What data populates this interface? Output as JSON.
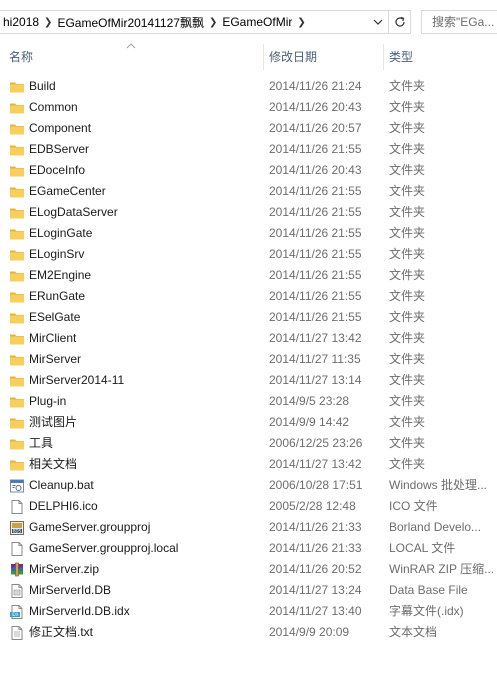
{
  "address": {
    "crumbs": [
      "hi2018",
      "EGameOfMir20141127飘飘",
      "EGameOfMir"
    ],
    "search_placeholder": "搜索\"EGa..."
  },
  "columns": {
    "name": "名称",
    "date": "修改日期",
    "type": "类型"
  },
  "colors": {
    "folder": "#f3c54a",
    "header_text": "#4c607a",
    "meta_text": "#6d6d6d"
  },
  "files": [
    {
      "name": "Build",
      "date": "2014/11/26 21:24",
      "type": "文件夹",
      "icon": "folder-icon"
    },
    {
      "name": "Common",
      "date": "2014/11/26 20:43",
      "type": "文件夹",
      "icon": "folder-icon"
    },
    {
      "name": "Component",
      "date": "2014/11/26 20:57",
      "type": "文件夹",
      "icon": "folder-icon"
    },
    {
      "name": "EDBServer",
      "date": "2014/11/26 21:55",
      "type": "文件夹",
      "icon": "folder-icon"
    },
    {
      "name": "EDoceInfo",
      "date": "2014/11/26 20:43",
      "type": "文件夹",
      "icon": "folder-icon"
    },
    {
      "name": "EGameCenter",
      "date": "2014/11/26 21:55",
      "type": "文件夹",
      "icon": "folder-icon"
    },
    {
      "name": "ELogDataServer",
      "date": "2014/11/26 21:55",
      "type": "文件夹",
      "icon": "folder-icon"
    },
    {
      "name": "ELoginGate",
      "date": "2014/11/26 21:55",
      "type": "文件夹",
      "icon": "folder-icon"
    },
    {
      "name": "ELoginSrv",
      "date": "2014/11/26 21:55",
      "type": "文件夹",
      "icon": "folder-icon"
    },
    {
      "name": "EM2Engine",
      "date": "2014/11/26 21:55",
      "type": "文件夹",
      "icon": "folder-icon"
    },
    {
      "name": "ERunGate",
      "date": "2014/11/26 21:55",
      "type": "文件夹",
      "icon": "folder-icon"
    },
    {
      "name": "ESelGate",
      "date": "2014/11/26 21:55",
      "type": "文件夹",
      "icon": "folder-icon"
    },
    {
      "name": "MirClient",
      "date": "2014/11/27 13:42",
      "type": "文件夹",
      "icon": "folder-icon"
    },
    {
      "name": "MirServer",
      "date": "2014/11/27 11:35",
      "type": "文件夹",
      "icon": "folder-icon"
    },
    {
      "name": "MirServer2014-11",
      "date": "2014/11/27 13:14",
      "type": "文件夹",
      "icon": "folder-icon"
    },
    {
      "name": "Plug-in",
      "date": "2014/9/5 23:28",
      "type": "文件夹",
      "icon": "folder-icon"
    },
    {
      "name": "测试图片",
      "date": "2014/9/9 14:42",
      "type": "文件夹",
      "icon": "folder-icon"
    },
    {
      "name": "工具",
      "date": "2006/12/25 23:26",
      "type": "文件夹",
      "icon": "folder-icon"
    },
    {
      "name": "相关文档",
      "date": "2014/11/27 13:42",
      "type": "文件夹",
      "icon": "folder-icon"
    },
    {
      "name": "Cleanup.bat",
      "date": "2006/10/28 17:51",
      "type": "Windows 批处理...",
      "icon": "batch-file-icon"
    },
    {
      "name": "DELPHI6.ico",
      "date": "2005/2/28 12:48",
      "type": "ICO 文件",
      "icon": "ico-file-icon"
    },
    {
      "name": "GameServer.groupproj",
      "date": "2014/11/26 21:33",
      "type": "Borland Develo...",
      "icon": "borland-project-icon"
    },
    {
      "name": "GameServer.groupproj.local",
      "date": "2014/11/26 21:33",
      "type": "LOCAL 文件",
      "icon": "blank-file-icon"
    },
    {
      "name": "MirServer.zip",
      "date": "2014/11/26 20:52",
      "type": "WinRAR ZIP 压缩...",
      "icon": "winrar-archive-icon"
    },
    {
      "name": "MirServerId.DB",
      "date": "2014/11/27 13:24",
      "type": "Data Base File",
      "icon": "database-file-icon"
    },
    {
      "name": "MirServerId.DB.idx",
      "date": "2014/11/27 13:40",
      "type": "字幕文件(.idx)",
      "icon": "subtitle-file-icon"
    },
    {
      "name": "修正文档.txt",
      "date": "2014/9/9 20:09",
      "type": "文本文档",
      "icon": "text-file-icon"
    }
  ]
}
